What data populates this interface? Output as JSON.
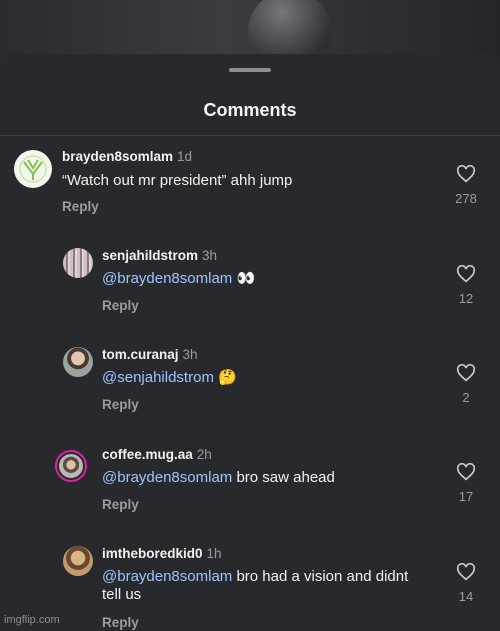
{
  "sheet": {
    "title": "Comments"
  },
  "comments": [
    {
      "username": "brayden8somlam",
      "time": "1d",
      "text_plain": "“Watch out mr president” ahh jump",
      "reply_label": "Reply",
      "likes": "278",
      "avatar_icon": "green-leaf-logo-avatar"
    },
    {
      "username": "senjahildstrom",
      "time": "3h",
      "mention": "@brayden8somlam",
      "text_rest": " 👀",
      "reply_label": "Reply",
      "likes": "12",
      "avatar_icon": "photo-avatar"
    },
    {
      "username": "tom.curanaj",
      "time": "3h",
      "mention": "@senjahildstrom",
      "text_rest": " 🤔",
      "reply_label": "Reply",
      "likes": "2",
      "avatar_icon": "photo-avatar"
    },
    {
      "username": "coffee.mug.aa",
      "time": "2h",
      "mention": "@brayden8somlam",
      "text_rest": " bro saw ahead",
      "reply_label": "Reply",
      "likes": "17",
      "avatar_icon": "story-ring-avatar"
    },
    {
      "username": "imtheboredkid0",
      "time": "1h",
      "mention": "@brayden8somlam",
      "text_rest": " bro had a vision and didnt tell us",
      "reply_label": "Reply",
      "likes": "14",
      "avatar_icon": "photo-avatar"
    }
  ],
  "watermark": "imgflip.com",
  "colors": {
    "background": "#27292d",
    "mention": "#9ec4ff",
    "muted": "#9a9ca0",
    "story_ring": "#d6249f"
  }
}
